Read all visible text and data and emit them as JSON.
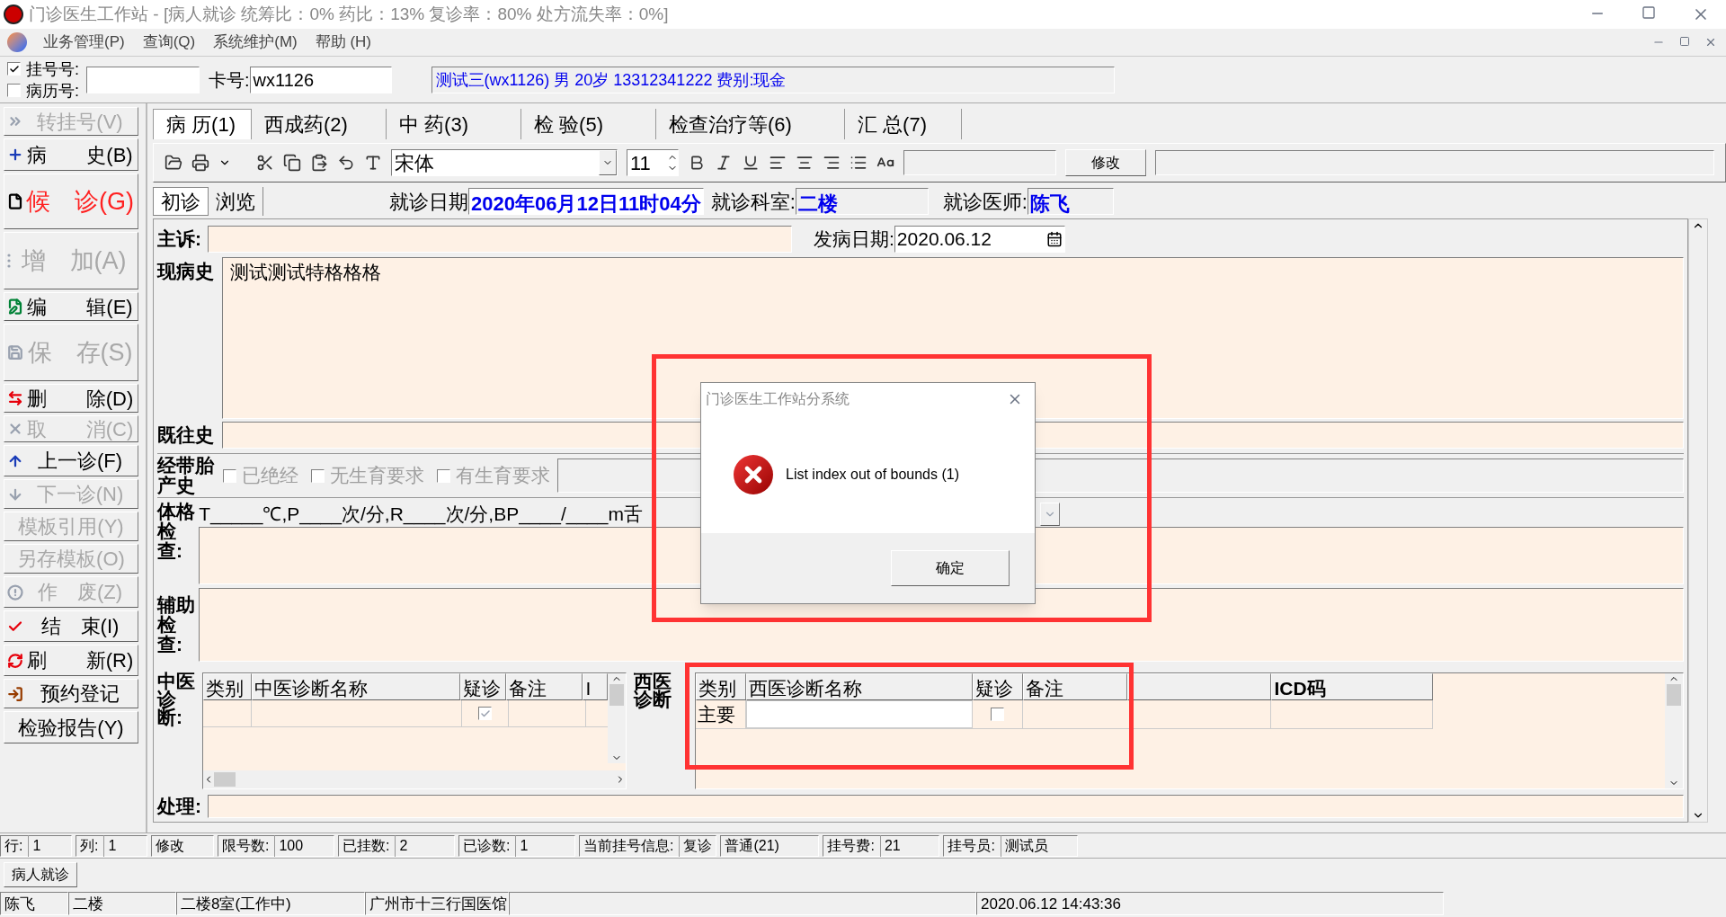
{
  "window": {
    "title": "门诊医生工作站 - [病人就诊 统筹比：0% 药比：13% 复诊率：80% 处方流失率：0%]"
  },
  "menu": [
    "业务管理(P)",
    "查询(Q)",
    "系统维护(M)",
    "帮助 (H)"
  ],
  "registration": {
    "options": [
      {
        "label": "挂号号:",
        "checked": true
      },
      {
        "label": "病历号:",
        "checked": false
      }
    ],
    "card_label": "卡号:",
    "card_value": "wx1126",
    "patient_info": "测试三(wx1126) 男 20岁 13312341222 费别:现金"
  },
  "sidebar": [
    {
      "label": "转挂号(V)",
      "disabled": true,
      "highlighted": false
    },
    {
      "label": "病　　史(B)",
      "disabled": false,
      "highlighted": false
    },
    {
      "label": "候　诊(G)",
      "disabled": false,
      "highlighted": true
    },
    {
      "label": "增　加(A)",
      "disabled": true,
      "highlighted": false
    },
    {
      "label": "编　　辑(E)",
      "disabled": false,
      "highlighted": false
    },
    {
      "label": "保　存(S)",
      "disabled": true,
      "highlighted": false
    },
    {
      "label": "删　　除(D)",
      "disabled": false,
      "highlighted": false
    },
    {
      "label": "取　　消(C)",
      "disabled": true,
      "highlighted": false
    },
    {
      "label": "上一诊(F)",
      "disabled": false,
      "highlighted": false
    },
    {
      "label": "下一诊(N)",
      "disabled": true,
      "highlighted": false
    },
    {
      "label": "模板引用(Y)",
      "disabled": true,
      "highlighted": false
    },
    {
      "label": "另存模板(O)",
      "disabled": true,
      "highlighted": false
    },
    {
      "label": "作　废(Z)",
      "disabled": true,
      "highlighted": false
    },
    {
      "label": "结　束(I)",
      "disabled": false,
      "highlighted": false
    },
    {
      "label": "刷　　新(R)",
      "disabled": false,
      "highlighted": false
    },
    {
      "label": "预约登记",
      "disabled": false,
      "highlighted": false
    },
    {
      "label": "检验报告(Y)",
      "disabled": false,
      "highlighted": false
    }
  ],
  "tabs": [
    {
      "label": "病 历(1)",
      "selected": true
    },
    {
      "label": "西成药(2)",
      "selected": false
    },
    {
      "label": "中 药(3)",
      "selected": false
    },
    {
      "label": "检 验(5)",
      "selected": false
    },
    {
      "label": "检查治疗等(6)",
      "selected": false
    },
    {
      "label": "汇 总(7)",
      "selected": false
    }
  ],
  "toolbar": {
    "font": "宋体",
    "font_size": "11",
    "edit_button": "修改"
  },
  "record_tabs": [
    {
      "label": "初诊",
      "selected": true
    },
    {
      "label": "浏览",
      "selected": false
    }
  ],
  "visit": {
    "date_label": "就诊日期",
    "date": "2020年06月12日11时04分",
    "dept_label": "就诊科室:",
    "dept": "二楼",
    "doctor_label": "就诊医师:",
    "doctor": "陈飞"
  },
  "form": {
    "complaint_label": "主诉:",
    "onset_label": "发病日期:",
    "onset_date": "2020.06.12",
    "present_label": "现病史",
    "present_text": "测试测试特格格格",
    "past_label": "既往史",
    "obstetric_label": "经带胎产史",
    "obstetric_options": [
      {
        "label": "已绝经",
        "checked": false
      },
      {
        "label": "无生育要求",
        "checked": false
      },
      {
        "label": "有生育要求",
        "checked": false
      }
    ],
    "exam_label": "体格检查:",
    "exam_template": "T_____℃,P____次/分,R____次/分,BP____/____m舌",
    "aux_label": "辅助检查:",
    "treatment_label": "处理:"
  },
  "tcm_diagnosis": {
    "label": "中医诊断:",
    "columns": [
      "类别",
      "中医诊断名称",
      "疑诊",
      "备注",
      "I"
    ],
    "rows": [
      {
        "suspected": true
      }
    ]
  },
  "western_diagnosis": {
    "label": "西医诊断",
    "columns": [
      "类别",
      "西医诊断名称",
      "疑诊",
      "备注",
      "ICD码"
    ],
    "rows": [
      {
        "type": "主要",
        "suspected": false
      }
    ]
  },
  "status_bar": [
    {
      "label": "行:",
      "value": "1"
    },
    {
      "label": "列:",
      "value": "1"
    },
    {
      "value": "修改"
    },
    {
      "label": "限号数:",
      "value": "100"
    },
    {
      "label": "已挂数:",
      "value": "2"
    },
    {
      "label": "已诊数:",
      "value": "1"
    },
    {
      "label": "当前挂号信息:",
      "value": "复诊"
    },
    {
      "value": "普通(21)"
    },
    {
      "label": "挂号费:",
      "value": "21"
    },
    {
      "label": "挂号员:",
      "value": "测试员"
    }
  ],
  "bottom_tab": "病人就诊",
  "bottom_bar": [
    "陈飞",
    "二楼",
    "二楼8室(工作中)",
    "广州市十三行国医馆",
    "2020.06.12 14:43:36"
  ],
  "dialog": {
    "title": "门诊医生工作站分系统",
    "message": "List index out of bounds (1)",
    "button": "确定"
  }
}
